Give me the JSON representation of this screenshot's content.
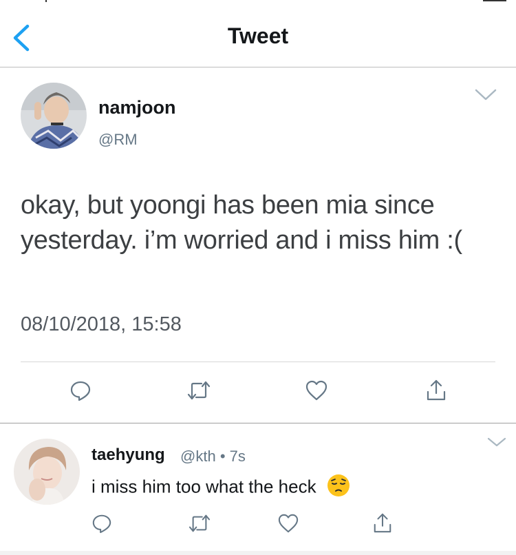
{
  "nav": {
    "title": "Tweet",
    "back_icon": "chevron-left-icon",
    "accent_color": "#1da1f2"
  },
  "main_tweet": {
    "author_name": "namjoon",
    "author_handle": "@RM",
    "text": "okay, but yoongi has been mia since yesterday. i’m worried and i miss him :(",
    "timestamp": "08/10/2018, 15:58",
    "actions": [
      "reply-icon",
      "retweet-icon",
      "like-icon",
      "share-icon"
    ]
  },
  "reply": {
    "author_name": "taehyung",
    "author_handle": "@kth",
    "time": "7s",
    "separator": "•",
    "text": "i miss him too what the heck",
    "emoji": "pensive-face-emoji",
    "actions": [
      "reply-icon",
      "retweet-icon",
      "like-icon",
      "share-icon"
    ]
  },
  "colors": {
    "text_primary": "#14171a",
    "text_secondary": "#657786",
    "icon": "#657786"
  }
}
